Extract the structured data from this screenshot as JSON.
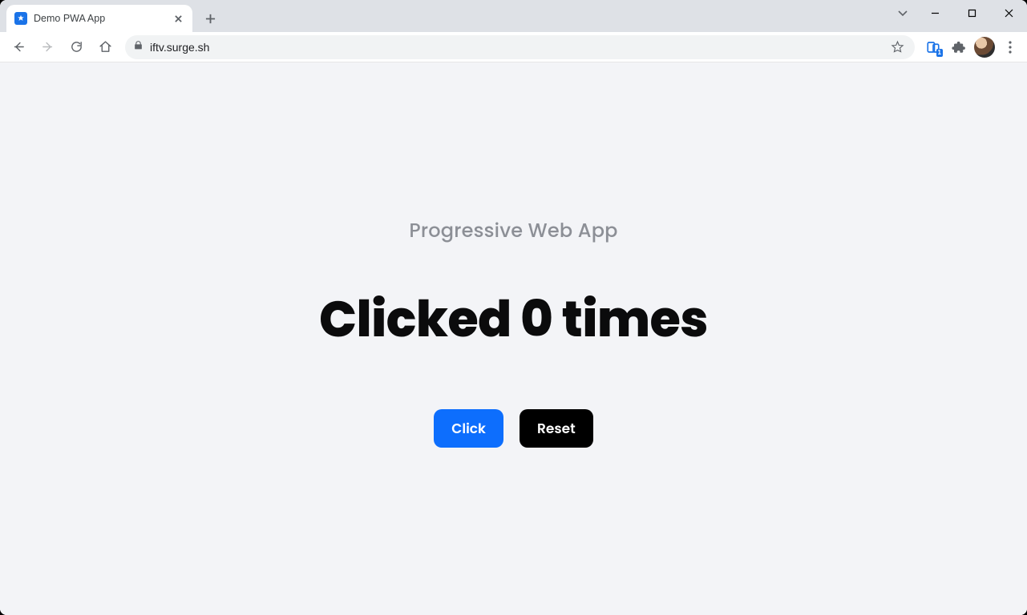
{
  "browser": {
    "tab": {
      "title": "Demo PWA App"
    },
    "url": "iftv.surge.sh",
    "devtools_badge": "1"
  },
  "page": {
    "subtitle": "Progressive Web App",
    "counter_text": "Clicked 0 times",
    "buttons": {
      "click": "Click",
      "reset": "Reset"
    }
  }
}
